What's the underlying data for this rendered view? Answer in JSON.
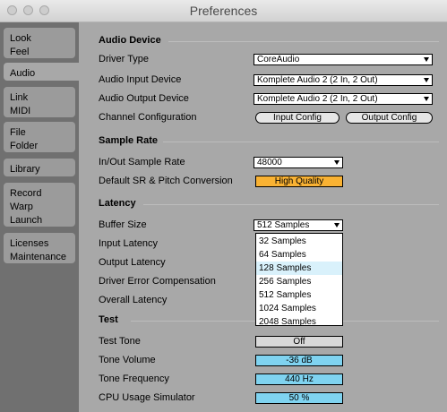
{
  "window": {
    "title": "Preferences"
  },
  "sidebar": {
    "tabs": [
      {
        "lines": [
          "Look",
          "Feel"
        ]
      },
      {
        "lines": [
          "Audio"
        ]
      },
      {
        "lines": [
          "Link",
          "MIDI"
        ]
      },
      {
        "lines": [
          "File",
          "Folder"
        ]
      },
      {
        "lines": [
          "Library"
        ]
      },
      {
        "lines": [
          "Record",
          "Warp",
          "Launch"
        ]
      },
      {
        "lines": [
          "Licenses",
          "Maintenance"
        ]
      }
    ]
  },
  "audio_device": {
    "section_title": "Audio Device",
    "driver_type": {
      "label": "Driver Type",
      "value": "CoreAudio"
    },
    "input_device": {
      "label": "Audio Input Device",
      "value": "Komplete Audio 2 (2 In, 2 Out)"
    },
    "output_device": {
      "label": "Audio Output Device",
      "value": "Komplete Audio 2 (2 In, 2 Out)"
    },
    "channel_config": {
      "label": "Channel Configuration",
      "input_button": "Input Config",
      "output_button": "Output Config"
    }
  },
  "sample_rate": {
    "section_title": "Sample Rate",
    "in_out": {
      "label": "In/Out Sample Rate",
      "value": "48000"
    },
    "default_conversion": {
      "label": "Default SR & Pitch Conversion",
      "value": "High Quality",
      "color": "#f9b233"
    }
  },
  "latency": {
    "section_title": "Latency",
    "buffer_size": {
      "label": "Buffer Size",
      "value": "512 Samples",
      "options": [
        "32 Samples",
        "64 Samples",
        "128 Samples",
        "256 Samples",
        "512 Samples",
        "1024 Samples",
        "2048 Samples"
      ],
      "highlighted_option": "128 Samples"
    },
    "input_latency": {
      "label": "Input Latency"
    },
    "output_latency": {
      "label": "Output Latency"
    },
    "driver_error": {
      "label": "Driver Error Compensation"
    },
    "overall": {
      "label": "Overall Latency"
    }
  },
  "test": {
    "section_title": "Test",
    "test_tone": {
      "label": "Test Tone",
      "value": "Off"
    },
    "tone_volume": {
      "label": "Tone Volume",
      "value": "-36 dB",
      "color": "#7fd3f0"
    },
    "tone_frequency": {
      "label": "Tone Frequency",
      "value": "440 Hz",
      "color": "#7fd3f0"
    },
    "cpu_sim": {
      "label": "CPU Usage Simulator",
      "value": "50 %",
      "color": "#7fd3f0"
    }
  }
}
